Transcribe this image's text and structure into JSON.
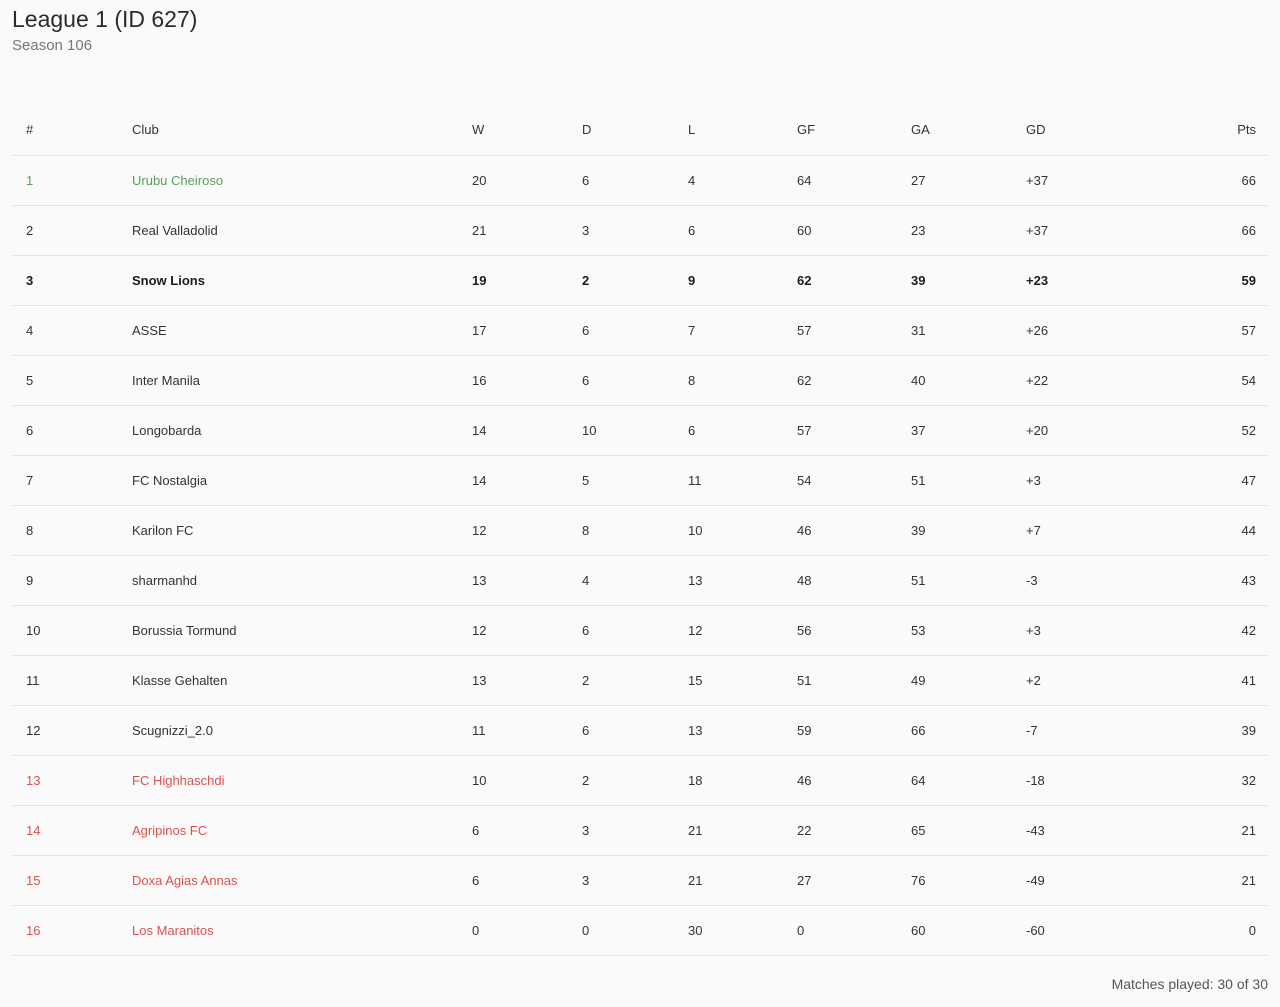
{
  "header": {
    "title": "League 1 (ID 627)",
    "subtitle": "Season 106"
  },
  "table": {
    "columns": [
      "#",
      "Club",
      "W",
      "D",
      "L",
      "GF",
      "GA",
      "GD",
      "Pts"
    ],
    "rows": [
      {
        "pos": "1",
        "club": "Urubu Cheiroso",
        "w": "20",
        "d": "6",
        "l": "4",
        "gf": "64",
        "ga": "27",
        "gd": "+37",
        "pts": "66",
        "status": "promo"
      },
      {
        "pos": "2",
        "club": "Real Valladolid",
        "w": "21",
        "d": "3",
        "l": "6",
        "gf": "60",
        "ga": "23",
        "gd": "+37",
        "pts": "66",
        "status": ""
      },
      {
        "pos": "3",
        "club": "Snow Lions",
        "w": "19",
        "d": "2",
        "l": "9",
        "gf": "62",
        "ga": "39",
        "gd": "+23",
        "pts": "59",
        "status": "bold"
      },
      {
        "pos": "4",
        "club": "ASSE",
        "w": "17",
        "d": "6",
        "l": "7",
        "gf": "57",
        "ga": "31",
        "gd": "+26",
        "pts": "57",
        "status": ""
      },
      {
        "pos": "5",
        "club": "Inter Manila",
        "w": "16",
        "d": "6",
        "l": "8",
        "gf": "62",
        "ga": "40",
        "gd": "+22",
        "pts": "54",
        "status": ""
      },
      {
        "pos": "6",
        "club": "Longobarda",
        "w": "14",
        "d": "10",
        "l": "6",
        "gf": "57",
        "ga": "37",
        "gd": "+20",
        "pts": "52",
        "status": ""
      },
      {
        "pos": "7",
        "club": "FC Nostalgia",
        "w": "14",
        "d": "5",
        "l": "11",
        "gf": "54",
        "ga": "51",
        "gd": "+3",
        "pts": "47",
        "status": ""
      },
      {
        "pos": "8",
        "club": "Karilon FC",
        "w": "12",
        "d": "8",
        "l": "10",
        "gf": "46",
        "ga": "39",
        "gd": "+7",
        "pts": "44",
        "status": ""
      },
      {
        "pos": "9",
        "club": "sharmanhd",
        "w": "13",
        "d": "4",
        "l": "13",
        "gf": "48",
        "ga": "51",
        "gd": "-3",
        "pts": "43",
        "status": ""
      },
      {
        "pos": "10",
        "club": "Borussia Tormund",
        "w": "12",
        "d": "6",
        "l": "12",
        "gf": "56",
        "ga": "53",
        "gd": "+3",
        "pts": "42",
        "status": ""
      },
      {
        "pos": "11",
        "club": "Klasse Gehalten",
        "w": "13",
        "d": "2",
        "l": "15",
        "gf": "51",
        "ga": "49",
        "gd": "+2",
        "pts": "41",
        "status": ""
      },
      {
        "pos": "12",
        "club": "Scugnizzi_2.0",
        "w": "11",
        "d": "6",
        "l": "13",
        "gf": "59",
        "ga": "66",
        "gd": "-7",
        "pts": "39",
        "status": ""
      },
      {
        "pos": "13",
        "club": "FC Highhaschdi",
        "w": "10",
        "d": "2",
        "l": "18",
        "gf": "46",
        "ga": "64",
        "gd": "-18",
        "pts": "32",
        "status": "releg"
      },
      {
        "pos": "14",
        "club": "Agripinos FC",
        "w": "6",
        "d": "3",
        "l": "21",
        "gf": "22",
        "ga": "65",
        "gd": "-43",
        "pts": "21",
        "status": "releg"
      },
      {
        "pos": "15",
        "club": "Doxa Agias Annas",
        "w": "6",
        "d": "3",
        "l": "21",
        "gf": "27",
        "ga": "76",
        "gd": "-49",
        "pts": "21",
        "status": "releg"
      },
      {
        "pos": "16",
        "club": "Los Maranitos",
        "w": "0",
        "d": "0",
        "l": "30",
        "gf": "0",
        "ga": "60",
        "gd": "-60",
        "pts": "0",
        "status": "releg"
      }
    ]
  },
  "footer": {
    "matches_played": "Matches played: 30 of 30"
  },
  "colors": {
    "promotion": "#5a9e5a",
    "relegation": "#d9534f",
    "text": "#333333",
    "divider": "#e2e2e2"
  }
}
